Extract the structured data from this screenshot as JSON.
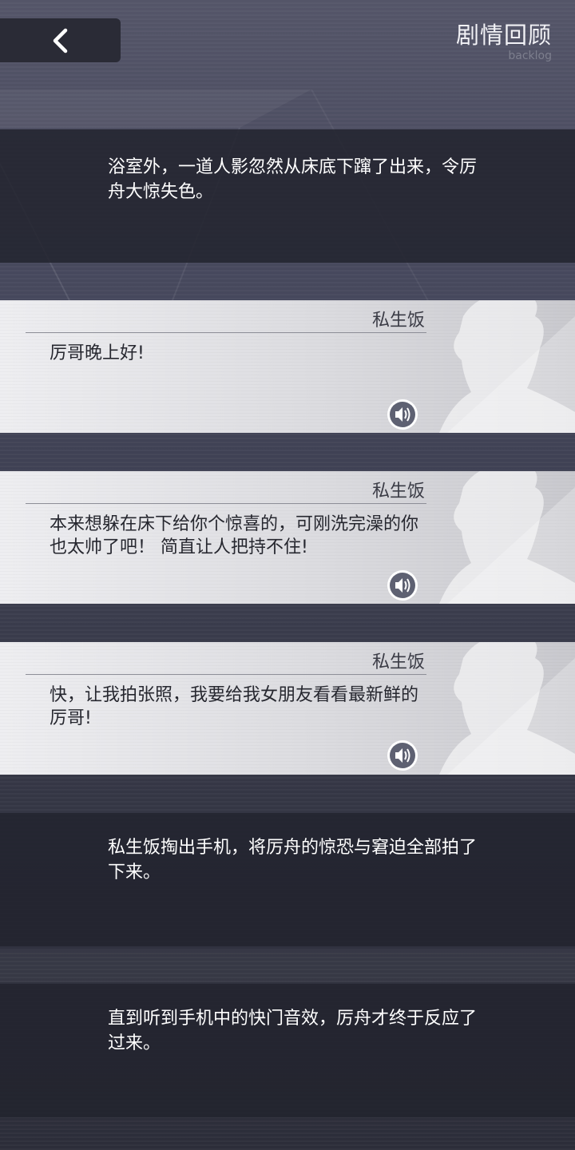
{
  "header": {
    "back_icon": "chevron-left-icon",
    "title": "剧情回顾",
    "subtitle": "backlog"
  },
  "entries": [
    {
      "type": "narration",
      "text": "浴室外，一道人影忽然从床底下蹿了出来，令厉舟大惊失色。"
    },
    {
      "type": "dialogue",
      "speaker": "私生饭",
      "text": "厉哥晚上好!",
      "voice_icon": "speaker-icon"
    },
    {
      "type": "dialogue",
      "speaker": "私生饭",
      "text": "本来想躲在床下给你个惊喜的，可刚洗完澡的你也太帅了吧！ 简直让人把持不住!",
      "voice_icon": "speaker-icon"
    },
    {
      "type": "dialogue",
      "speaker": "私生饭",
      "text": "快，让我拍张照，我要给我女朋友看看最新鲜的厉哥!",
      "voice_icon": "speaker-icon"
    },
    {
      "type": "narration",
      "text": "私生饭掏出手机，将厉舟的惊恐与窘迫全部拍了下来。"
    },
    {
      "type": "narration",
      "text": "直到听到手机中的快门音效，厉舟才终于反应了过来。"
    }
  ],
  "colors": {
    "background": "#3a3c4c",
    "narration_panel": "#22232e",
    "dialogue_panel": "#dcdce0",
    "accent": "#5e6172"
  }
}
